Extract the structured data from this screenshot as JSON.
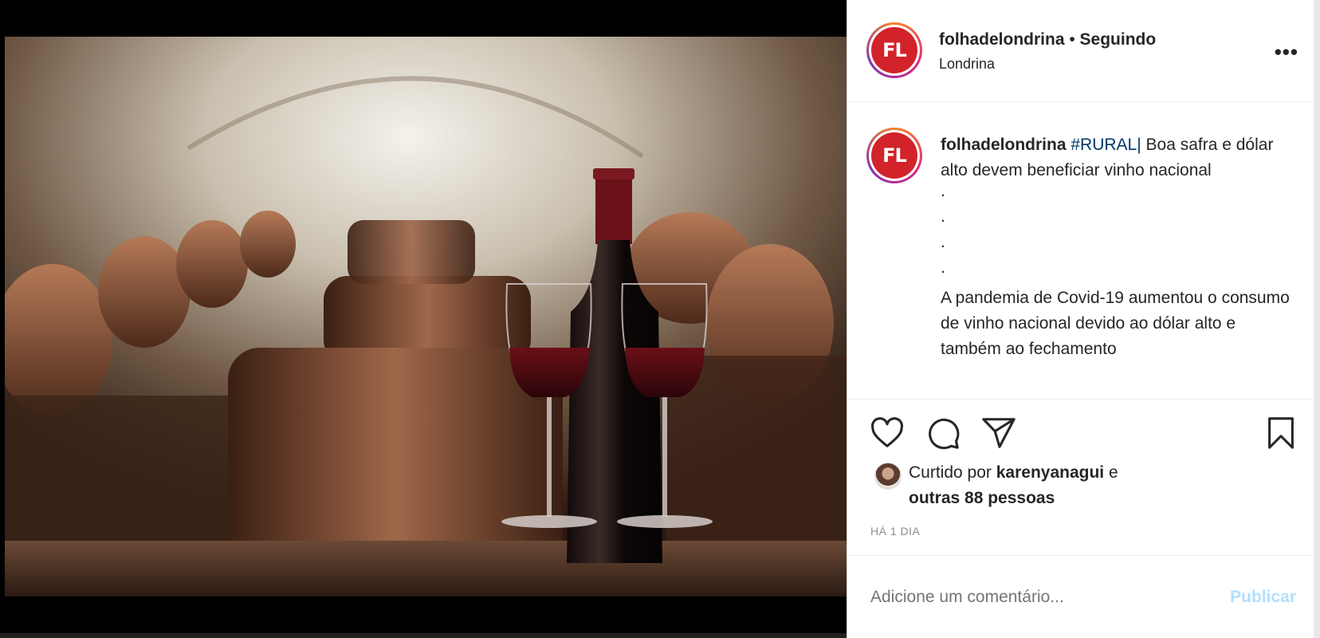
{
  "post": {
    "author": "folhadelondrina",
    "separator": "•",
    "follow_status": "Seguindo",
    "location": "Londrina",
    "avatar_text": "FL",
    "more_label": "•••"
  },
  "caption": {
    "author": "folhadelondrina",
    "hashtag": "#RURAL|",
    "headline": "Boa safra e dólar alto devem beneficiar vinho nacional",
    "dots": [
      ".",
      ".",
      ".",
      "."
    ],
    "body": "A pandemia de Covid-19 aumentou o consumo de vinho nacional devido ao dólar alto e também ao fechamento"
  },
  "actions": {
    "icons": [
      "heart-icon",
      "comment-icon",
      "share-icon",
      "bookmark-icon"
    ]
  },
  "likes": {
    "prefix": "Curtido por",
    "user": "karenyanagui",
    "conjunction": "e",
    "others": "outras 88 pessoas"
  },
  "timestamp": "HÁ 1 DIA",
  "comment": {
    "placeholder": "Adicione um comentário...",
    "publish_label": "Publicar"
  },
  "colors": {
    "brand_red": "#d2232a",
    "link_blue": "#00376b",
    "publish_disabled": "#b2dffc"
  }
}
